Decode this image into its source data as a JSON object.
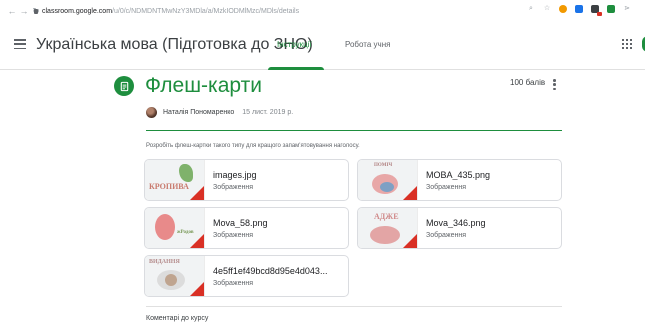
{
  "browser": {
    "back_glyph": "←",
    "forward_glyph": "→",
    "reload_glyph": "↻",
    "url_host": "classroom.google.com",
    "url_path": "/u/0/c/NDMDNTMwNzY3MDla/a/MzkIODMlMzc/MDls/details",
    "zoom_glyph": "⌕",
    "star_glyph": "☆",
    "more_glyph": "⋗"
  },
  "header": {
    "course_title": "Українська мова (Підготовка до ЗНО)",
    "tabs": [
      {
        "label": "Інструкції",
        "active": true
      },
      {
        "label": "Робота учня",
        "active": false
      }
    ]
  },
  "assignment": {
    "title": "Флеш-карти",
    "points": "100 балів",
    "author": "Наталія Пономаренко",
    "date": "15 лист. 2019 р.",
    "instructions": "Розробіть флеш-картки такого типу для кращого запам'ятовування наголосу."
  },
  "attachments": [
    {
      "name": "images.jpg",
      "type": "Зображення",
      "thumb_text": "КРОПИВА"
    },
    {
      "name": "MOBA_435.png",
      "type": "Зображення",
      "thumb_text": "ПОМІЧ"
    },
    {
      "name": "Mova_58.png",
      "type": "Зображення",
      "thumb_text": "жРодов"
    },
    {
      "name": "Mova_346.png",
      "type": "Зображення",
      "thumb_text": "АДЖЕ"
    },
    {
      "name": "4e5ff1ef49bcd8d95e4d043...",
      "type": "Зображення",
      "thumb_text": "ВИДАННЯ"
    }
  ],
  "comments": {
    "label": "Коментарі до курсу"
  },
  "colors": {
    "accent": "#1e8e3e",
    "corner_mark": "#d93025"
  }
}
